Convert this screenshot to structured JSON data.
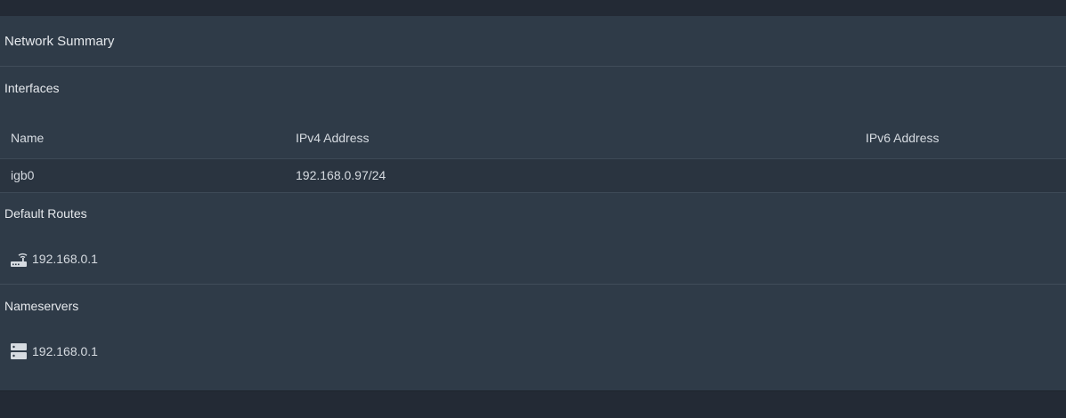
{
  "panel": {
    "title": "Network Summary"
  },
  "interfaces": {
    "title": "Interfaces",
    "columns": [
      "Name",
      "IPv4 Address",
      "IPv6 Address"
    ],
    "rows": [
      {
        "name": "igb0",
        "ipv4": "192.168.0.97/24",
        "ipv6": ""
      }
    ]
  },
  "default_routes": {
    "title": "Default Routes",
    "items": [
      {
        "icon": "router-icon",
        "value": "192.168.0.1"
      }
    ]
  },
  "nameservers": {
    "title": "Nameservers",
    "items": [
      {
        "icon": "server-icon",
        "value": "192.168.0.1"
      }
    ]
  },
  "colors": {
    "page_background": "#232a35",
    "panel_background": "#2f3b48",
    "row_background": "#2a3440",
    "text": "#dfe3e8"
  }
}
